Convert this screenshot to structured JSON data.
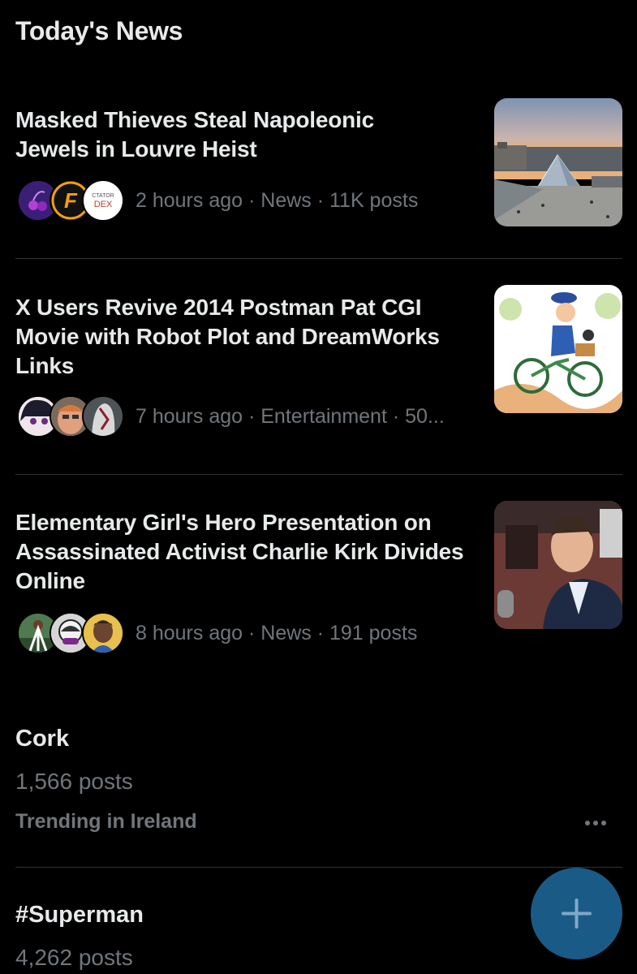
{
  "section": {
    "title": "Today's News"
  },
  "news": [
    {
      "headline": "Masked Thieves Steal Napoleonic Jewels in Louvre Heist",
      "meta": "2 hours ago · News · 11K posts",
      "avatar_texts": {
        "logo_letter": "F",
        "top": "CTATOR",
        "bottom": "DEX"
      },
      "thumb": "louvre-pyramid-photo"
    },
    {
      "headline": "X Users Revive 2014 Postman Pat CGI Movie with Robot Plot and DreamWorks Links",
      "meta": "7 hours ago · Entertainment · 50...",
      "thumb": "postman-pat-bicycle-illustration"
    },
    {
      "headline": "Elementary Girl's Hero Presentation on Assassinated Activist Charlie Kirk Divides Online",
      "meta": "8 hours ago · News · 191 posts",
      "thumb": "speaker-at-microphone-photo"
    }
  ],
  "trends": [
    {
      "name": "Cork",
      "count": "1,566 posts",
      "context": "Trending in Ireland"
    },
    {
      "name": "#Superman",
      "count": "4,262 posts"
    }
  ],
  "icons": {
    "more": "more-horizontal-icon",
    "compose": "plus-icon"
  },
  "colors": {
    "background": "#000000",
    "text": "#e7e9ea",
    "secondary": "#71767b",
    "fab": "#1a5a86",
    "divider": "#2f3336"
  }
}
